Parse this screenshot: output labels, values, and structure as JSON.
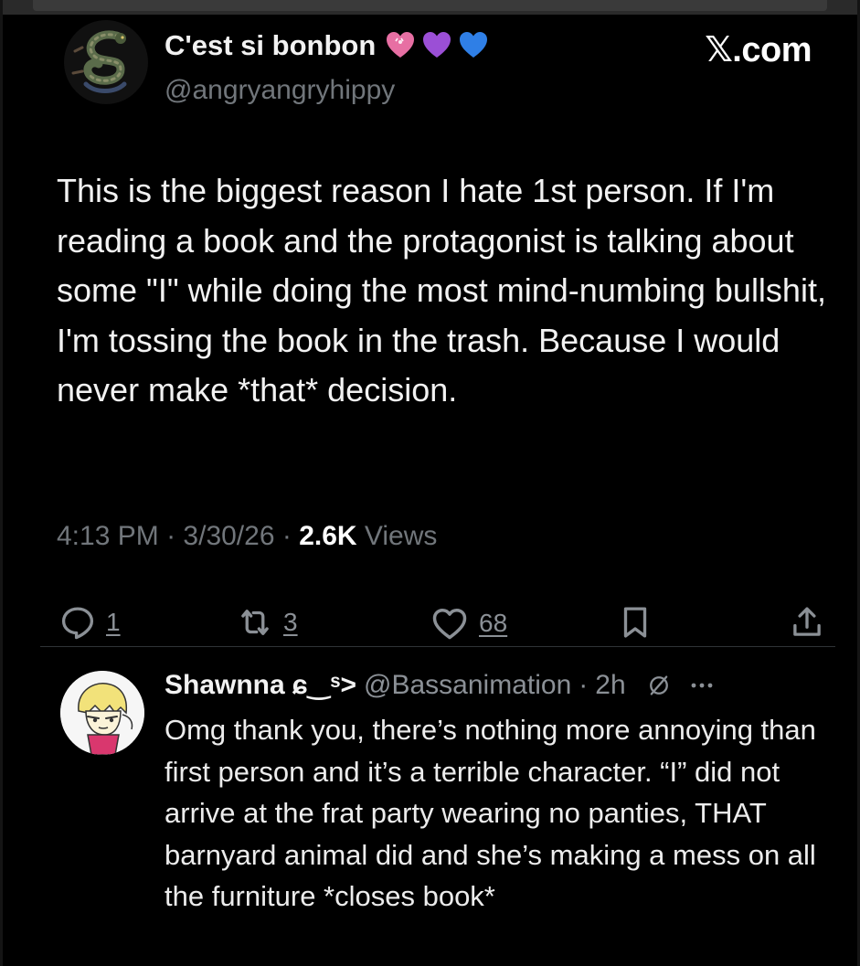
{
  "tweet": {
    "display_name": "C'est si bonbon",
    "name_emojis": [
      "pink-heart",
      "purple-heart",
      "blue-heart"
    ],
    "handle": "@angryangryhippy",
    "site": "𝕏.com",
    "text": "This is the biggest reason I hate 1st person. If I'm reading a book and the protagonist is talking about some \"I\" while doing the most mind-numbing bullshit, I'm tossing the book in the trash. Because I would never make *that* decision.",
    "time": "4:13 PM",
    "date": "3/30/26",
    "separator": "·",
    "views_count": "2.6K",
    "views_label": "Views",
    "actions": {
      "replies": "1",
      "reposts": "3",
      "likes": "68"
    }
  },
  "reply": {
    "display_name": "Shawnna",
    "name_suffix": "ɕ‿ˢ>",
    "handle": "@Bassanimation",
    "separator": "·",
    "time": "2h",
    "text": "Omg thank you, there’s nothing more annoying than first person and it’s a terrible character. “I” did not arrive at the frat party wearing no panties, THAT barnyard animal did and she’s making a mess on all the furniture *closes book*"
  },
  "colors": {
    "background": "#000000",
    "text": "#f2f2f2",
    "muted": "#71767b",
    "divider": "#2f3336",
    "pink_heart": "#e76fa3",
    "purple_heart": "#9b4fd6",
    "blue_heart": "#2f7fe6"
  }
}
